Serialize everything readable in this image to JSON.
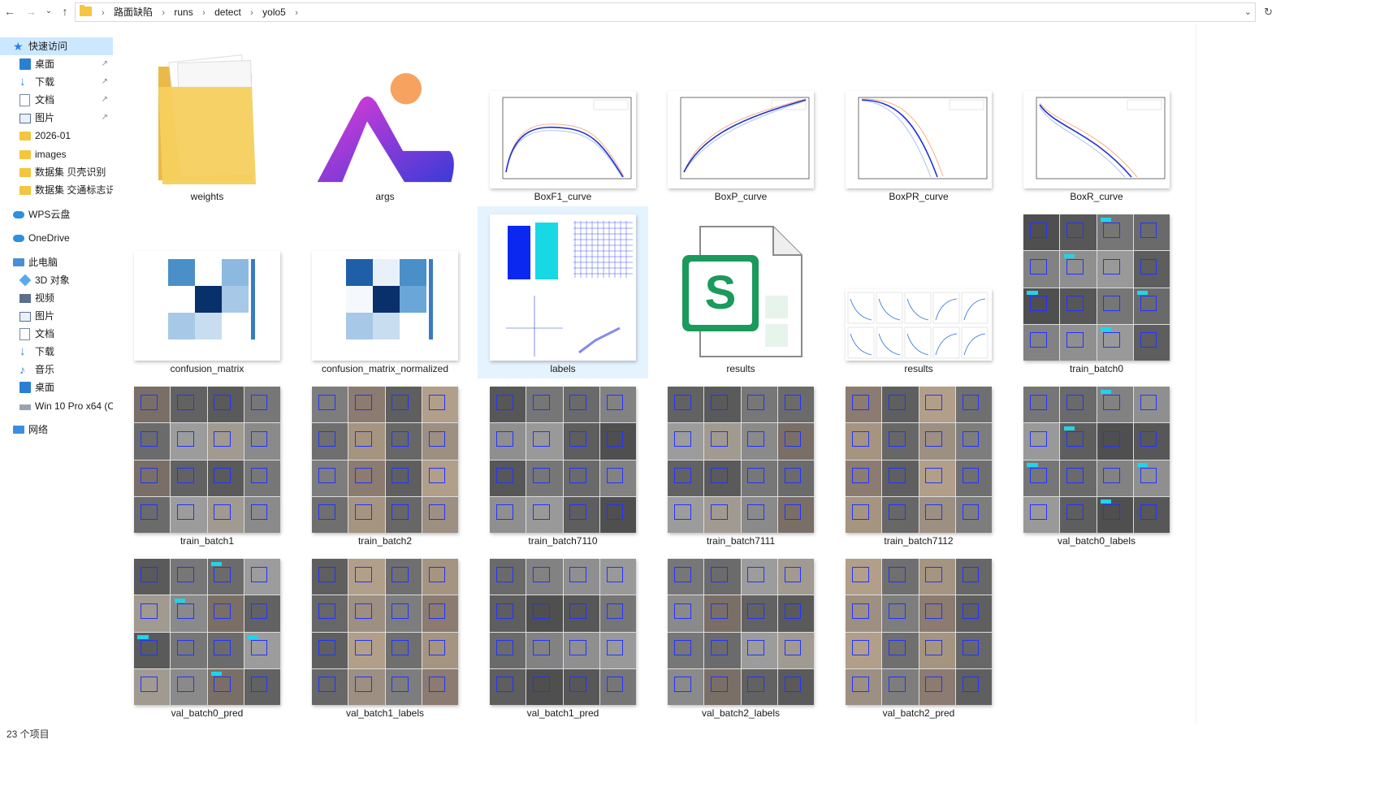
{
  "address": {
    "crumbs": [
      "路面缺陷",
      "runs",
      "detect",
      "yolo5"
    ]
  },
  "sidebar": {
    "items": [
      {
        "label": "快速访问",
        "icon": "star-icon",
        "indent": 0
      },
      {
        "label": "桌面",
        "icon": "desktop-icon",
        "indent": 1,
        "pinned": true
      },
      {
        "label": "下载",
        "icon": "download-icon",
        "indent": 1,
        "pinned": true
      },
      {
        "label": "文档",
        "icon": "document-icon",
        "indent": 1,
        "pinned": true
      },
      {
        "label": "图片",
        "icon": "pictures-icon",
        "indent": 1,
        "pinned": true
      },
      {
        "label": "2026-01",
        "icon": "folder-icon",
        "indent": 1
      },
      {
        "label": "images",
        "icon": "folder-icon",
        "indent": 1
      },
      {
        "label": "数据集 贝壳识别",
        "icon": "folder-icon",
        "indent": 1
      },
      {
        "label": "数据集 交通标志识别",
        "icon": "folder-icon",
        "indent": 1
      },
      {
        "label": "WPS云盘",
        "icon": "cloud-icon",
        "indent": 0
      },
      {
        "label": "OneDrive",
        "icon": "cloud-icon",
        "indent": 0
      },
      {
        "label": "此电脑",
        "icon": "computer-icon",
        "indent": 0
      },
      {
        "label": "3D 对象",
        "icon": "3d-objects-icon",
        "indent": 1
      },
      {
        "label": "视频",
        "icon": "video-icon",
        "indent": 1
      },
      {
        "label": "图片",
        "icon": "pictures-icon",
        "indent": 1
      },
      {
        "label": "文档",
        "icon": "document-icon",
        "indent": 1
      },
      {
        "label": "下载",
        "icon": "download-icon",
        "indent": 1
      },
      {
        "label": "音乐",
        "icon": "music-icon",
        "indent": 1
      },
      {
        "label": "桌面",
        "icon": "desktop-icon",
        "indent": 1
      },
      {
        "label": "Win 10 Pro x64 (C",
        "icon": "drive-icon",
        "indent": 1
      },
      {
        "label": "网络",
        "icon": "network-icon",
        "indent": 0
      }
    ]
  },
  "files": [
    {
      "name": "weights",
      "kind": "folder"
    },
    {
      "name": "args",
      "kind": "app-logo"
    },
    {
      "name": "BoxF1_curve",
      "kind": "curve"
    },
    {
      "name": "BoxP_curve",
      "kind": "curve"
    },
    {
      "name": "BoxPR_curve",
      "kind": "curve"
    },
    {
      "name": "BoxR_curve",
      "kind": "curve"
    },
    {
      "name": "confusion_matrix",
      "kind": "matrix"
    },
    {
      "name": "confusion_matrix_normalized",
      "kind": "matrix"
    },
    {
      "name": "labels",
      "kind": "labels",
      "selected": true
    },
    {
      "name": "results",
      "kind": "spreadsheet"
    },
    {
      "name": "results",
      "kind": "results-grid"
    },
    {
      "name": "train_batch0",
      "kind": "mosaic"
    },
    {
      "name": "train_batch1",
      "kind": "mosaic"
    },
    {
      "name": "train_batch2",
      "kind": "mosaic"
    },
    {
      "name": "train_batch7110",
      "kind": "mosaic"
    },
    {
      "name": "train_batch7111",
      "kind": "mosaic"
    },
    {
      "name": "train_batch7112",
      "kind": "mosaic"
    },
    {
      "name": "val_batch0_labels",
      "kind": "mosaic"
    },
    {
      "name": "val_batch0_pred",
      "kind": "mosaic"
    },
    {
      "name": "val_batch1_labels",
      "kind": "mosaic"
    },
    {
      "name": "val_batch1_pred",
      "kind": "mosaic"
    },
    {
      "name": "val_batch2_labels",
      "kind": "mosaic"
    },
    {
      "name": "val_batch2_pred",
      "kind": "mosaic"
    }
  ],
  "status": {
    "item_count": "23 个项目"
  },
  "colors": {
    "selection": "#cce8ff",
    "folder": "#f6c542",
    "accent": "#2b7de9"
  }
}
